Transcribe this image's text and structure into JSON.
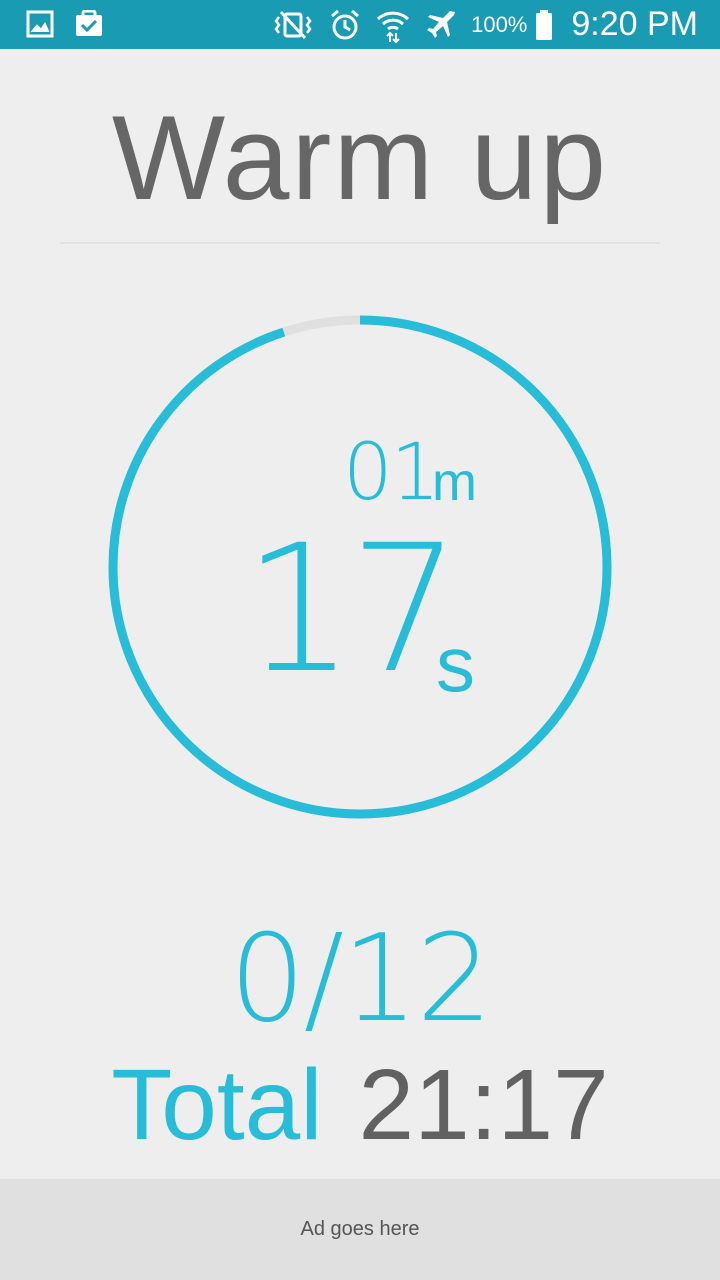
{
  "status_bar": {
    "icons_left": [
      "gallery-icon",
      "clipboard-check-icon"
    ],
    "icons_right": [
      "vibrate-off-icon",
      "alarm-icon",
      "wifi-icon",
      "airplane-mode-icon",
      "battery-icon"
    ],
    "battery_percent": "100%",
    "time": "9:20 PM",
    "background": "#1a9bb4"
  },
  "phase": {
    "title": "Warm up"
  },
  "timer": {
    "minutes": "01",
    "minutes_unit": "m",
    "seconds": "17",
    "seconds_unit": "s",
    "progress_fraction": 0.95,
    "accent_color": "#27bcd8",
    "track_color": "#e0e0e0"
  },
  "rounds": {
    "counter": "0/12"
  },
  "total": {
    "label": "Total",
    "value": "21:17"
  },
  "ad": {
    "text": "Ad goes here"
  }
}
